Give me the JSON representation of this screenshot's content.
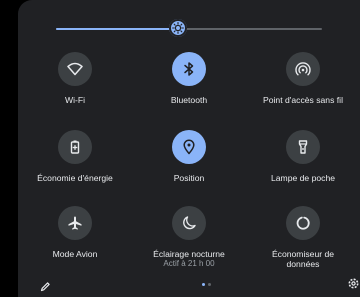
{
  "brightness": {
    "level": 0.46
  },
  "tiles": [
    {
      "label": "Wi-Fi",
      "icon": "wifi-icon",
      "active": false
    },
    {
      "label": "Bluetooth",
      "icon": "bluetooth-icon",
      "active": true
    },
    {
      "label": "Point d'accès sans fil",
      "icon": "hotspot-icon",
      "active": false
    },
    {
      "label": "Économie d'énergie",
      "icon": "battery-saver-icon",
      "active": false
    },
    {
      "label": "Position",
      "icon": "location-icon",
      "active": true
    },
    {
      "label": "Lampe de poche",
      "icon": "flashlight-icon",
      "active": false
    },
    {
      "label": "Mode Avion",
      "icon": "airplane-icon",
      "active": false
    },
    {
      "label": "Éclairage nocturne",
      "sublabel": "Actif à 21 h 00",
      "icon": "night-light-icon",
      "active": false
    },
    {
      "label": "Économiseur de",
      "label2": "données",
      "icon": "data-saver-icon",
      "active": false
    }
  ],
  "pager": {
    "pages": 2,
    "current": 1
  },
  "colors": {
    "accent": "#8ab4f8",
    "tile_off": "#3c4043",
    "panel": "#202124"
  }
}
